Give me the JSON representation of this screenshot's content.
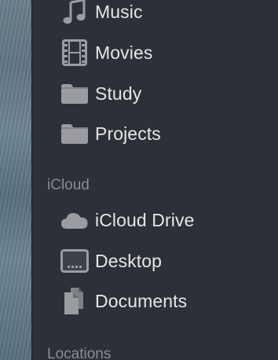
{
  "favorites": {
    "items": [
      {
        "label": "Music",
        "icon": "music-note-icon"
      },
      {
        "label": "Movies",
        "icon": "film-strip-icon"
      },
      {
        "label": "Study",
        "icon": "folder-icon"
      },
      {
        "label": "Projects",
        "icon": "folder-icon"
      }
    ]
  },
  "icloud": {
    "header": "iCloud",
    "items": [
      {
        "label": "iCloud Drive",
        "icon": "cloud-icon"
      },
      {
        "label": "Desktop",
        "icon": "desktop-icon"
      },
      {
        "label": "Documents",
        "icon": "documents-icon"
      }
    ]
  },
  "locations": {
    "header": "Locations"
  },
  "colors": {
    "sidebar_bg": "#2e3037",
    "label_text": "#e6e6e8",
    "section_text": "#8b8d93",
    "icon_gray": "#9a9ca2"
  }
}
